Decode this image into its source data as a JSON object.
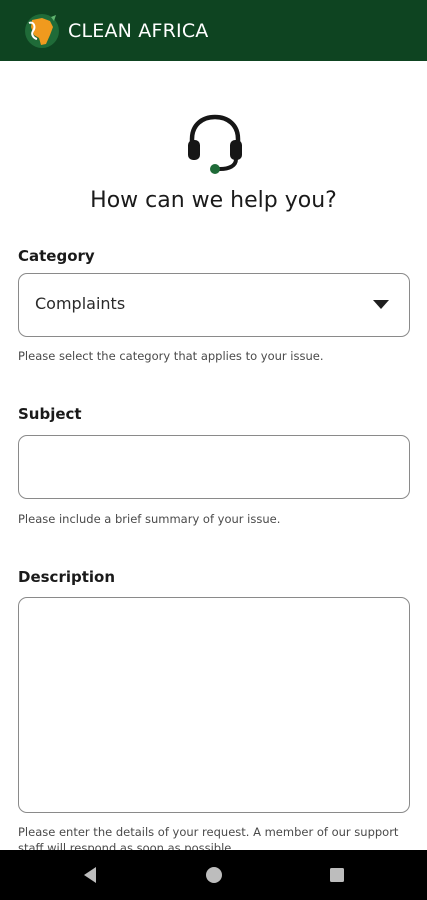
{
  "app": {
    "brand": "CLEAN AFRICA",
    "colors": {
      "header": "#0e4421",
      "accent": "#1f6b38",
      "logo_orange": "#f09a1e"
    }
  },
  "page": {
    "icon": "headset-icon",
    "title": "How can we help you?"
  },
  "form": {
    "category": {
      "label": "Category",
      "value": "Complaints",
      "helper": "Please select the category that applies to your issue."
    },
    "subject": {
      "label": "Subject",
      "value": "",
      "helper": "Please include a brief summary of your issue."
    },
    "description": {
      "label": "Description",
      "value": "",
      "helper": "Please enter the details of your request. A member of our support staff will respond as soon as possible."
    }
  },
  "navbar": {
    "back": "back-icon",
    "home": "home-icon",
    "recents": "recents-icon"
  }
}
